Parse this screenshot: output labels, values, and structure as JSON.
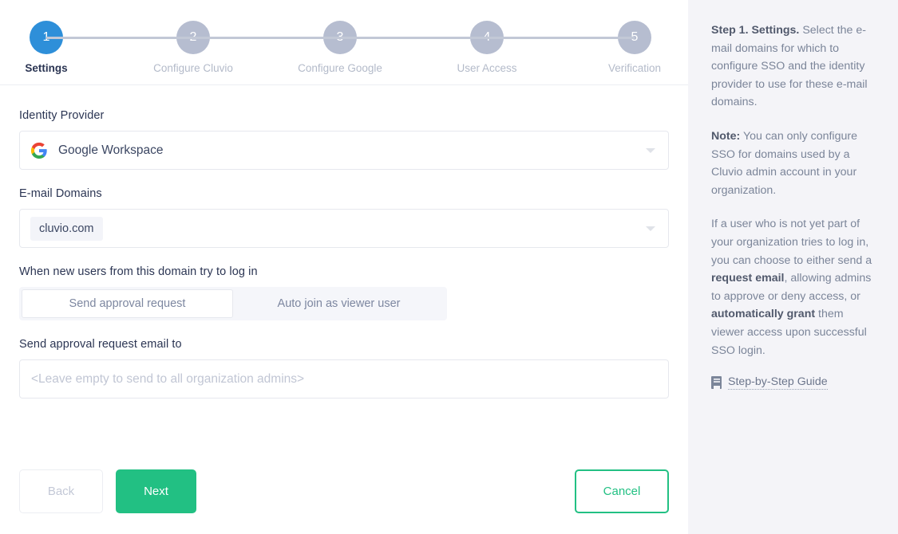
{
  "stepper": {
    "steps": [
      {
        "number": "1",
        "label": "Settings",
        "active": true
      },
      {
        "number": "2",
        "label": "Configure Cluvio",
        "active": false
      },
      {
        "number": "3",
        "label": "Configure Google",
        "active": false
      },
      {
        "number": "4",
        "label": "User Access",
        "active": false
      },
      {
        "number": "5",
        "label": "Verification",
        "active": false
      }
    ],
    "active_color": "#2e8fd9",
    "inactive_color": "#b6bdd0"
  },
  "form": {
    "identity_provider": {
      "label": "Identity Provider",
      "value": "Google Workspace",
      "icon": "google-g-icon"
    },
    "email_domains": {
      "label": "E-mail Domains",
      "tags": [
        "cluvio.com"
      ]
    },
    "new_user_policy": {
      "label": "When new users from this domain try to log in",
      "options": [
        {
          "label": "Send approval request",
          "selected": true
        },
        {
          "label": "Auto join as viewer user",
          "selected": false
        }
      ]
    },
    "approval_email": {
      "label": "Send approval request email to",
      "value": "",
      "placeholder": "<Leave empty to send to all organization admins>"
    }
  },
  "footer": {
    "back_label": "Back",
    "next_label": "Next",
    "cancel_label": "Cancel",
    "accent_green": "#22c083"
  },
  "help": {
    "paragraph1_lead": "Step 1. Settings.",
    "paragraph1_rest": " Select the e-mail domains for which to configure SSO and the identity provider to use for these e-mail domains.",
    "paragraph2_lead": "Note:",
    "paragraph2_rest": " You can only configure SSO for domains used by a Cluvio admin account in your organization.",
    "paragraph3_part1": "If a user who is not yet part of your organization tries to log in, you can choose to either send a ",
    "paragraph3_bold1": "request email",
    "paragraph3_part2": ", allowing admins to approve or deny access, or ",
    "paragraph3_bold2": "automatically grant",
    "paragraph3_part3": " them viewer access upon successful SSO login.",
    "guide_link_label": "Step-by-Step Guide",
    "guide_icon": "book-icon"
  }
}
